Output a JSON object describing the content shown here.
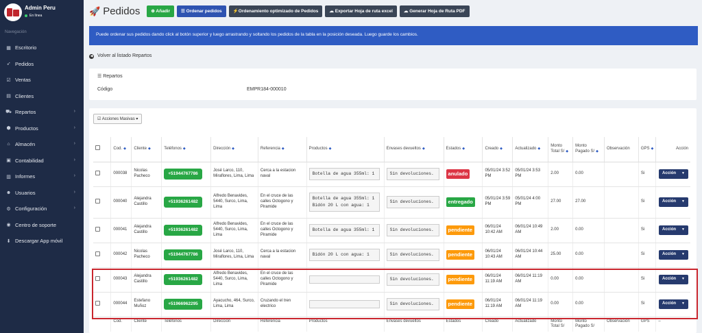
{
  "user": {
    "name": "Admin Peru",
    "status": "En línea"
  },
  "sidebar": {
    "nav_label": "Navegación",
    "items": [
      {
        "label": "Escritorio",
        "icon": "dashboard-icon",
        "chevron": false
      },
      {
        "label": "Pedidos",
        "icon": "rocket-icon",
        "chevron": false
      },
      {
        "label": "Ventas",
        "icon": "checkbox-icon",
        "chevron": false
      },
      {
        "label": "Clientes",
        "icon": "id-card-icon",
        "chevron": false
      },
      {
        "label": "Repartos",
        "icon": "truck-icon",
        "chevron": true
      },
      {
        "label": "Productos",
        "icon": "cube-icon",
        "chevron": true
      },
      {
        "label": "Almacén",
        "icon": "warehouse-icon",
        "chevron": true
      },
      {
        "label": "Contabilidad",
        "icon": "calculator-icon",
        "chevron": true
      },
      {
        "label": "Informes",
        "icon": "chart-icon",
        "chevron": true
      },
      {
        "label": "Usuarios",
        "icon": "users-icon",
        "chevron": true
      },
      {
        "label": "Configuración",
        "icon": "gears-icon",
        "chevron": true
      },
      {
        "label": "Centro de soporte",
        "icon": "help-icon",
        "chevron": false
      },
      {
        "label": "Descargar App móvil",
        "icon": "download-icon",
        "chevron": false
      }
    ]
  },
  "header": {
    "title": "Pedidos",
    "buttons": {
      "add": "Añadir",
      "order": "Ordenar pedidos",
      "optimized": "Ordenamiento optimizado de Pedidos",
      "export": "Exportar Hoja de ruta excel",
      "pdf": "Generar Hoja de Ruta PDF"
    }
  },
  "alert": "Puede ordenar sus pedidos dando click al botón superior y luego arrastrando y soltando los pedidos de la tabla en la posición deseada. Luego guarde los cambios.",
  "back_link": "Volver al listado Repartos",
  "repartos": {
    "header": "Repartos",
    "code_label": "Código",
    "code_value": "EMPR184-000010"
  },
  "bulk_actions": "Acciones Masivas",
  "table": {
    "headers": {
      "cod": "Cod.",
      "cliente": "Cliente",
      "telefonos": "Teléfonos",
      "direccion": "Dirección",
      "referencia": "Referencia",
      "productos": "Productos",
      "envases": "Envases devueltos",
      "estados": "Estados",
      "creado": "Creado",
      "actualizado": "Actualizado",
      "monto": "Monto Total S/",
      "pagado": "Monto Pagado S/",
      "observacion": "Observación",
      "gps": "GPS",
      "accion": "Acción"
    },
    "footer": {
      "cod": "Cod.",
      "cliente": "Cliente",
      "telefonos": "Teléfonos",
      "direccion": "Dirección",
      "referencia": "Referencia",
      "productos": "Productos",
      "envases": "Envases devueltos",
      "estados": "Estados",
      "creado": "Creado",
      "actualizado": "Actualizado",
      "monto": "Monto Total S/",
      "pagado": "Monto Pagado S/",
      "observacion": "Observación",
      "gps": "GPS",
      "accion": "–"
    },
    "rows": [
      {
        "cod": "000038",
        "cliente": "Nicolas Pacheco",
        "telefono": "+51944767786",
        "direccion": "José Larco, 110, Miraflores, Lima, Lima",
        "referencia": "Cerca a la estacion naval",
        "productos": "Botella de agua 355ml: 1",
        "envases": "Sin devoluciones.",
        "estado": "anulado",
        "creado": "05/01/24 3:52 PM",
        "actualizado": "05/01/24 3:53 PM",
        "monto": "2.00",
        "pagado": "0.00",
        "observacion": "",
        "gps": "Si",
        "accion": "Acción"
      },
      {
        "cod": "000040",
        "cliente": "Alejandra Castillo",
        "telefono": "+51936261482",
        "direccion": "Alfredo Benavides, 5440, Surco, Lima, Lima",
        "referencia": "En el cruce de las calles Octogono y Piramide",
        "productos": "Botella de agua 355ml: 1",
        "productos2": "Bidón 20 L con agua: 1",
        "envases": "Sin devoluciones.",
        "estado": "entregado",
        "creado": "05/01/24 3:59 PM",
        "actualizado": "05/01/24 4:00 PM",
        "monto": "27.00",
        "pagado": "27.00",
        "observacion": "",
        "gps": "Si",
        "accion": "Acción"
      },
      {
        "cod": "000041",
        "cliente": "Alejandra Castillo",
        "telefono": "+51936261482",
        "direccion": "Alfredo Benavides, 5440, Surco, Lima, Lima",
        "referencia": "En el cruce de las calles Octogono y Piramide",
        "productos": "Botella de agua 355ml: 1",
        "envases": "Sin devoluciones.",
        "estado": "pendiente",
        "creado": "06/01/24 10:42 AM",
        "actualizado": "06/01/24 10:49 AM",
        "monto": "2.00",
        "pagado": "0.00",
        "observacion": "",
        "gps": "Si",
        "accion": "Acción"
      },
      {
        "cod": "000042",
        "cliente": "Nicolas Pacheco",
        "telefono": "+51944767786",
        "direccion": "José Larco, 110, Miraflores, Lima, Lima",
        "referencia": "Cerca a la estacion naval",
        "productos": "Bidón 20 L con agua: 1",
        "envases": "Sin devoluciones.",
        "estado": "pendiente",
        "creado": "06/01/24 10:43 AM",
        "actualizado": "06/01/24 10:44 AM",
        "monto": "25.00",
        "pagado": "0.00",
        "observacion": "",
        "gps": "Si",
        "accion": "Acción"
      },
      {
        "cod": "000043",
        "cliente": "Alejandra Castillo",
        "telefono": "+51936261482",
        "direccion": "Alfredo Benavides, 5440, Surco, Lima, Lima",
        "referencia": "En el cruce de las calles Octogono y Piramide",
        "productos": "",
        "envases": "Sin devoluciones.",
        "estado": "pendiente",
        "creado": "06/01/24 11:19 AM",
        "actualizado": "06/01/24 11:19 AM",
        "monto": "0.00",
        "pagado": "0.00",
        "observacion": "",
        "gps": "Si",
        "accion": "Acción"
      },
      {
        "cod": "000044",
        "cliente": "Estefano Muñoz",
        "telefono": "+51966962295",
        "direccion": "Ayacucho, 464, Surco, Lima, Lima",
        "referencia": "Cruzando el tren electrico",
        "productos": "",
        "envases": "Sin devoluciones.",
        "estado": "pendiente",
        "creado": "06/01/24 11:19 AM",
        "actualizado": "06/01/24 11:19 AM",
        "monto": "0.00",
        "pagado": "0.00",
        "observacion": "",
        "gps": "Si",
        "accion": "Acción"
      }
    ]
  }
}
